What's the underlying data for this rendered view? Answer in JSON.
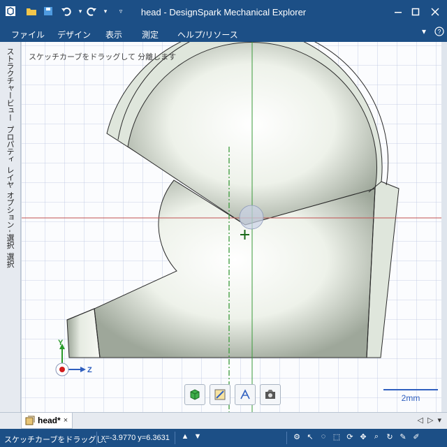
{
  "window": {
    "title": "head - DesignSpark Mechanical Explorer",
    "controls": [
      "minimize-icon",
      "maximize-icon",
      "close-icon"
    ]
  },
  "quick_access": [
    "app-logo-icon",
    "open-folder-icon",
    "save-icon",
    "undo-icon",
    "redo-icon",
    "customize-icon"
  ],
  "menu": {
    "items": [
      "ファイル",
      "デザイン",
      "表示",
      "測定",
      "ヘルプ/リソース"
    ],
    "extra": [
      "chevron-down-icon",
      "help-icon"
    ]
  },
  "left_tabs": [
    "ストラクチャー",
    "ビュー",
    "プロパティ",
    "レイヤ",
    "オプション - 選択",
    "選択"
  ],
  "viewport": {
    "hint": "スケッチカーブをドラッグして 分離します",
    "scale_label": "2mm",
    "axis_labels": {
      "y": "Y",
      "z": "Z"
    },
    "toolbar": [
      "solid-cube-icon",
      "sketch-edit-icon",
      "annotate-icon",
      "display-icon"
    ],
    "colors": {
      "model_fill": "#dfe6dc",
      "model_edge": "#2a2a2a",
      "grid": "#b8c3e0",
      "axis_red": "#c05050",
      "axis_green": "#3a9a3a",
      "scale": "#2f5fbf"
    }
  },
  "doc_tabs": {
    "active": "head*",
    "close": "×",
    "nav": [
      "◁",
      "▷",
      "▾"
    ]
  },
  "status": {
    "message": "スケッチカーブをドラッグし、",
    "coords": "x=-3.9770  y=6.3631",
    "icons": [
      "triangle-up-icon",
      "triangle-down-icon"
    ],
    "tools": [
      "settings-icon",
      "select-arrow-icon",
      "lasso-icon",
      "box-select-icon",
      "orbit-icon",
      "pan-icon",
      "zoom-icon",
      "spin-icon",
      "pencil-icon",
      "pen-icon"
    ]
  }
}
